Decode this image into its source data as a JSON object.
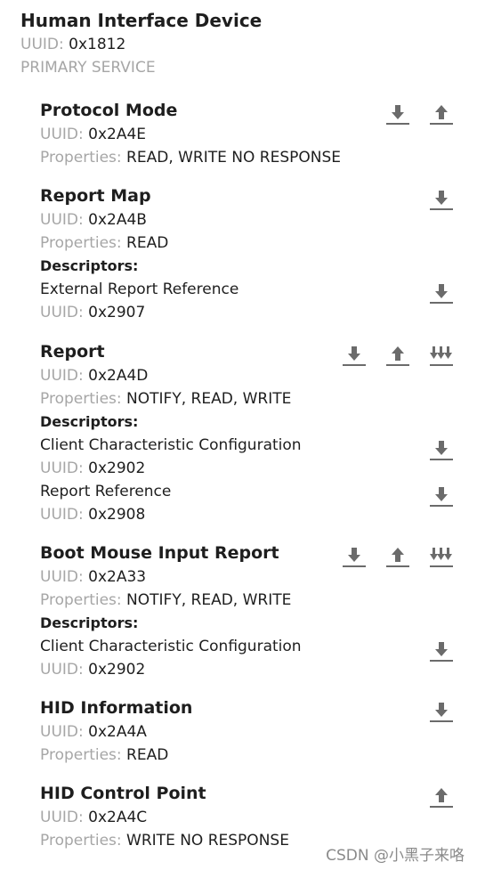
{
  "service": {
    "title": "Human Interface Device",
    "uuid_label": "UUID:",
    "uuid": "0x1812",
    "type": "PRIMARY SERVICE"
  },
  "characteristics": [
    {
      "name": "Protocol Mode",
      "uuid_label": "UUID:",
      "uuid": "0x2A4E",
      "props_label": "Properties:",
      "props": "READ, WRITE NO RESPONSE"
    },
    {
      "name": "Report Map",
      "uuid_label": "UUID:",
      "uuid": "0x2A4B",
      "props_label": "Properties:",
      "props": "READ",
      "descriptors_label": "Descriptors:",
      "descriptors": [
        {
          "name": "External Report Reference",
          "uuid_label": "UUID:",
          "uuid": "0x2907"
        }
      ]
    },
    {
      "name": "Report",
      "uuid_label": "UUID:",
      "uuid": "0x2A4D",
      "props_label": "Properties:",
      "props": "NOTIFY, READ, WRITE",
      "descriptors_label": "Descriptors:",
      "descriptors": [
        {
          "name": "Client Characteristic Configuration",
          "uuid_label": "UUID:",
          "uuid": "0x2902"
        },
        {
          "name": "Report Reference",
          "uuid_label": "UUID:",
          "uuid": "0x2908"
        }
      ]
    },
    {
      "name": "Boot Mouse Input Report",
      "uuid_label": "UUID:",
      "uuid": "0x2A33",
      "props_label": "Properties:",
      "props": "NOTIFY, READ, WRITE",
      "descriptors_label": "Descriptors:",
      "descriptors": [
        {
          "name": "Client Characteristic Configuration",
          "uuid_label": "UUID:",
          "uuid": "0x2902"
        }
      ]
    },
    {
      "name": "HID Information",
      "uuid_label": "UUID:",
      "uuid": "0x2A4A",
      "props_label": "Properties:",
      "props": "READ"
    },
    {
      "name": "HID Control Point",
      "uuid_label": "UUID:",
      "uuid": "0x2A4C",
      "props_label": "Properties:",
      "props": "WRITE NO RESPONSE"
    }
  ],
  "watermark": "CSDN @小黑子来咯",
  "icon_color": "#6b6b6b"
}
